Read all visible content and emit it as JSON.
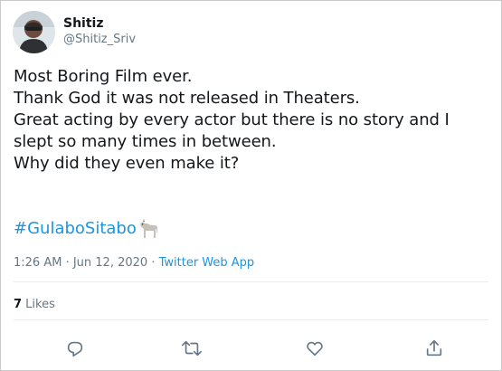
{
  "user": {
    "display_name": "Shitiz",
    "handle": "@Shitiz_Sriv"
  },
  "tweet": {
    "lines": [
      "Most Boring Film ever.",
      "Thank God it was not released in Theaters.",
      "Great acting by every actor but there is no story and I",
      "slept so many times in between.",
      "Why did they even make it?"
    ],
    "hashtag": "#GulaboSitabo",
    "hashtag_emoji": "goat-icon"
  },
  "meta": {
    "time": "1:26 AM",
    "separator": " · ",
    "date": "Jun 12, 2020",
    "separator2": " · ",
    "source": "Twitter Web App"
  },
  "stats": {
    "likes_count": "7",
    "likes_label": " Likes"
  },
  "actions": {
    "reply_icon": "reply-icon",
    "retweet_icon": "retweet-icon",
    "like_icon": "heart-icon",
    "share_icon": "share-icon"
  },
  "colors": {
    "link": "#1b95e0",
    "secondary_text": "#657786",
    "primary_text": "#14171a",
    "divider": "#e6ecf0"
  }
}
